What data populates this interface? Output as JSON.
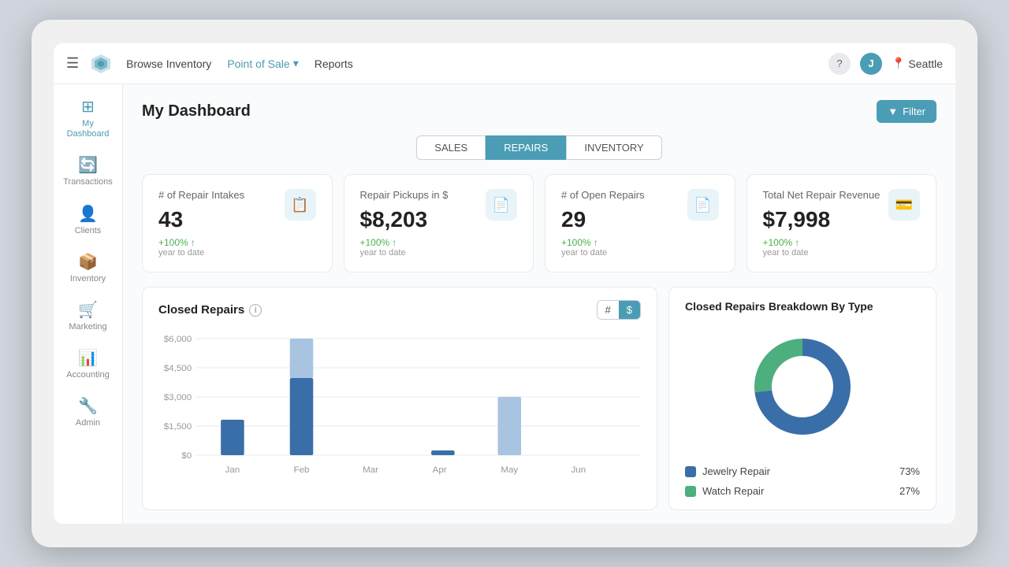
{
  "nav": {
    "hamburger": "☰",
    "links": [
      {
        "label": "Browse Inventory",
        "active": false
      },
      {
        "label": "Point of Sale",
        "active": true,
        "hasArrow": true
      },
      {
        "label": "Reports",
        "active": false
      }
    ],
    "avatar_initial": "J",
    "location_icon": "📍",
    "location": "Seattle"
  },
  "sidebar": {
    "items": [
      {
        "label": "My Dashboard",
        "icon": "⊞",
        "active": true
      },
      {
        "label": "Transactions",
        "icon": "🔄",
        "active": false
      },
      {
        "label": "Clients",
        "icon": "👤",
        "active": false
      },
      {
        "label": "Inventory",
        "icon": "📦",
        "active": false
      },
      {
        "label": "Marketing",
        "icon": "🛒",
        "active": false
      },
      {
        "label": "Accounting",
        "icon": "📊",
        "active": false
      },
      {
        "label": "Admin",
        "icon": "🔧",
        "active": false
      }
    ]
  },
  "page": {
    "title": "My Dashboard",
    "filter_label": "Filter"
  },
  "tabs": [
    {
      "label": "SALES",
      "active": false
    },
    {
      "label": "REPAIRS",
      "active": true
    },
    {
      "label": "INVENTORY",
      "active": false
    }
  ],
  "stat_cards": [
    {
      "label": "# of Repair Intakes",
      "value": "43",
      "change": "+100%",
      "period": "year to date",
      "icon": "📋"
    },
    {
      "label": "Repair Pickups in $",
      "value": "$8,203",
      "change": "+100%",
      "period": "year to date",
      "icon": "📄"
    },
    {
      "label": "# of Open Repairs",
      "value": "29",
      "change": "+100%",
      "period": "year to date",
      "icon": "📄"
    },
    {
      "label": "Total Net Repair Revenue",
      "value": "$7,998",
      "change": "+100%",
      "period": "year to date",
      "icon": "💳"
    }
  ],
  "bar_chart": {
    "title": "Closed Repairs",
    "toggle": {
      "hash": "#",
      "dollar": "$"
    },
    "y_labels": [
      "$6,000",
      "$4,500",
      "$3,000",
      "$1,500",
      "$0"
    ],
    "x_labels": [
      "Jan",
      "Feb",
      "Mar",
      "Apr",
      "May",
      "Jun"
    ],
    "bars": [
      {
        "month": "Jan",
        "dark": 30,
        "light": 0
      },
      {
        "month": "Feb",
        "dark": 75,
        "light": 90
      },
      {
        "month": "Mar",
        "dark": 0,
        "light": 0
      },
      {
        "month": "Apr",
        "dark": 5,
        "light": 0
      },
      {
        "month": "May",
        "dark": 0,
        "light": 45
      },
      {
        "month": "Jun",
        "dark": 0,
        "light": 0
      }
    ]
  },
  "donut_chart": {
    "title": "Closed Repairs Breakdown By Type",
    "segments": [
      {
        "label": "Jewelry Repair",
        "color": "#3a6ea8",
        "pct": "73%",
        "value": 73
      },
      {
        "label": "Watch Repair",
        "color": "#4caf7d",
        "pct": "27%",
        "value": 27
      }
    ]
  }
}
